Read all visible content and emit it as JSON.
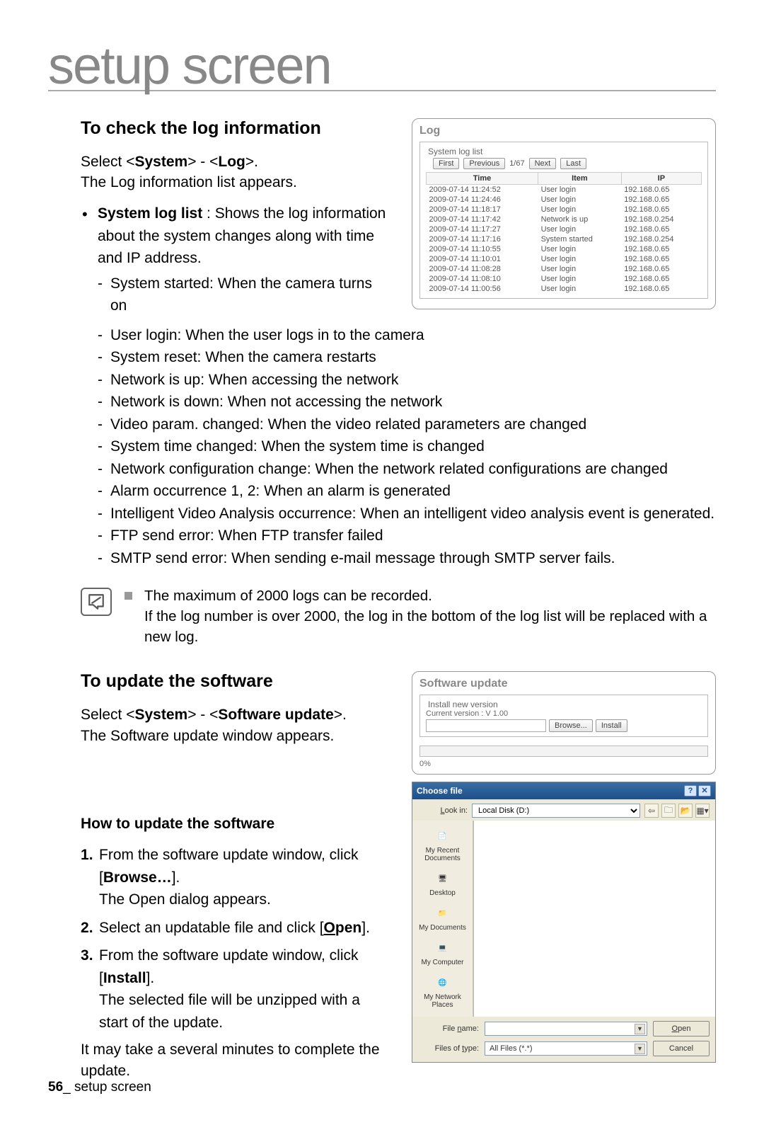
{
  "page": {
    "number": "56",
    "footer_label": "setup screen",
    "title": "setup screen"
  },
  "section1": {
    "heading": "To check the log information",
    "select_prefix": "Select <",
    "select_sys": "System",
    "select_mid": "> - <",
    "select_log": "Log",
    "select_suffix": ">.",
    "appears": "The Log information list appears.",
    "bullet_label_bold": "System log list",
    "bullet_label_rest": " : Shows the log information about the system changes along with time and IP address.",
    "dashes": [
      "System started: When the camera turns on",
      "User login: When the user logs in to the camera",
      "System reset: When the camera restarts",
      "Network is up: When accessing the network",
      "Network is down: When not accessing the network",
      "Video param. changed: When the video related parameters are changed",
      "System time changed: When the system time is changed",
      "Network configuration change: When the network related configurations are changed",
      "Alarm occurrence 1, 2: When an alarm is generated",
      "Intelligent Video Analysis occurrence: When an intelligent video analysis event is generated.",
      "FTP send error: When FTP transfer failed",
      "SMTP send error: When sending e-mail message through SMTP server fails."
    ],
    "note1": "The maximum of 2000 logs can be recorded.",
    "note2": "If the log number is over 2000, the log in the bottom of the log list will be replaced with a new log."
  },
  "log_panel": {
    "title": "Log",
    "fieldset": "System log list",
    "buttons": {
      "first": "First",
      "previous": "Previous",
      "next": "Next",
      "last": "Last"
    },
    "pager": "1/67",
    "headers": {
      "time": "Time",
      "item": "Item",
      "ip": "IP"
    },
    "rows": [
      {
        "time": "2009-07-14 11:24:52",
        "item": "User login",
        "ip": "192.168.0.65"
      },
      {
        "time": "2009-07-14 11:24:46",
        "item": "User login",
        "ip": "192.168.0.65"
      },
      {
        "time": "2009-07-14 11:18:17",
        "item": "User login",
        "ip": "192.168.0.65"
      },
      {
        "time": "2009-07-14 11:17:42",
        "item": "Network is up",
        "ip": "192.168.0.254"
      },
      {
        "time": "2009-07-14 11:17:27",
        "item": "User login",
        "ip": "192.168.0.65"
      },
      {
        "time": "2009-07-14 11:17:16",
        "item": "System started",
        "ip": "192.168.0.254"
      },
      {
        "time": "2009-07-14 11:10:55",
        "item": "User login",
        "ip": "192.168.0.65"
      },
      {
        "time": "2009-07-14 11:10:01",
        "item": "User login",
        "ip": "192.168.0.65"
      },
      {
        "time": "2009-07-14 11:08:28",
        "item": "User login",
        "ip": "192.168.0.65"
      },
      {
        "time": "2009-07-14 11:08:10",
        "item": "User login",
        "ip": "192.168.0.65"
      },
      {
        "time": "2009-07-14 11:00:56",
        "item": "User login",
        "ip": "192.168.0.65"
      }
    ]
  },
  "section2": {
    "heading": "To update the software",
    "select_prefix": "Select <",
    "select_sys": "System",
    "select_mid": "> - <",
    "select_sw": "Software update",
    "select_suffix": ">.",
    "appears": "The Software update window appears."
  },
  "sw_panel": {
    "title": "Software update",
    "fieldset": "Install new version",
    "current": "Current version : V 1.00",
    "browse": "Browse...",
    "install": "Install",
    "percent": "0%"
  },
  "section3": {
    "heading": "How to update the software",
    "steps": [
      {
        "pre": "From the software update window, click [",
        "bold": "Browse…",
        "post": "].",
        "extra": "The Open dialog appears."
      },
      {
        "pre": "Select an updatable file and click [",
        "underline_first": "O",
        "underline_rest": "pen",
        "post": "]."
      },
      {
        "pre": "From the software update window, click [",
        "bold": "Install",
        "post": "].",
        "extra": "The selected file will be unzipped with a start of the update."
      }
    ],
    "closing": "It may take a several minutes to complete the update."
  },
  "dialog": {
    "title": "Choose file",
    "lookin_label": "Look in:",
    "lookin_value": "Local Disk (D:)",
    "shortcuts": [
      "My Recent Documents",
      "Desktop",
      "My Documents",
      "My Computer",
      "My Network Places"
    ],
    "filename_label": "File name:",
    "filetype_label": "Files of type:",
    "filetype_value": "All Files (*.*)",
    "open": "Open",
    "cancel": "Cancel"
  }
}
